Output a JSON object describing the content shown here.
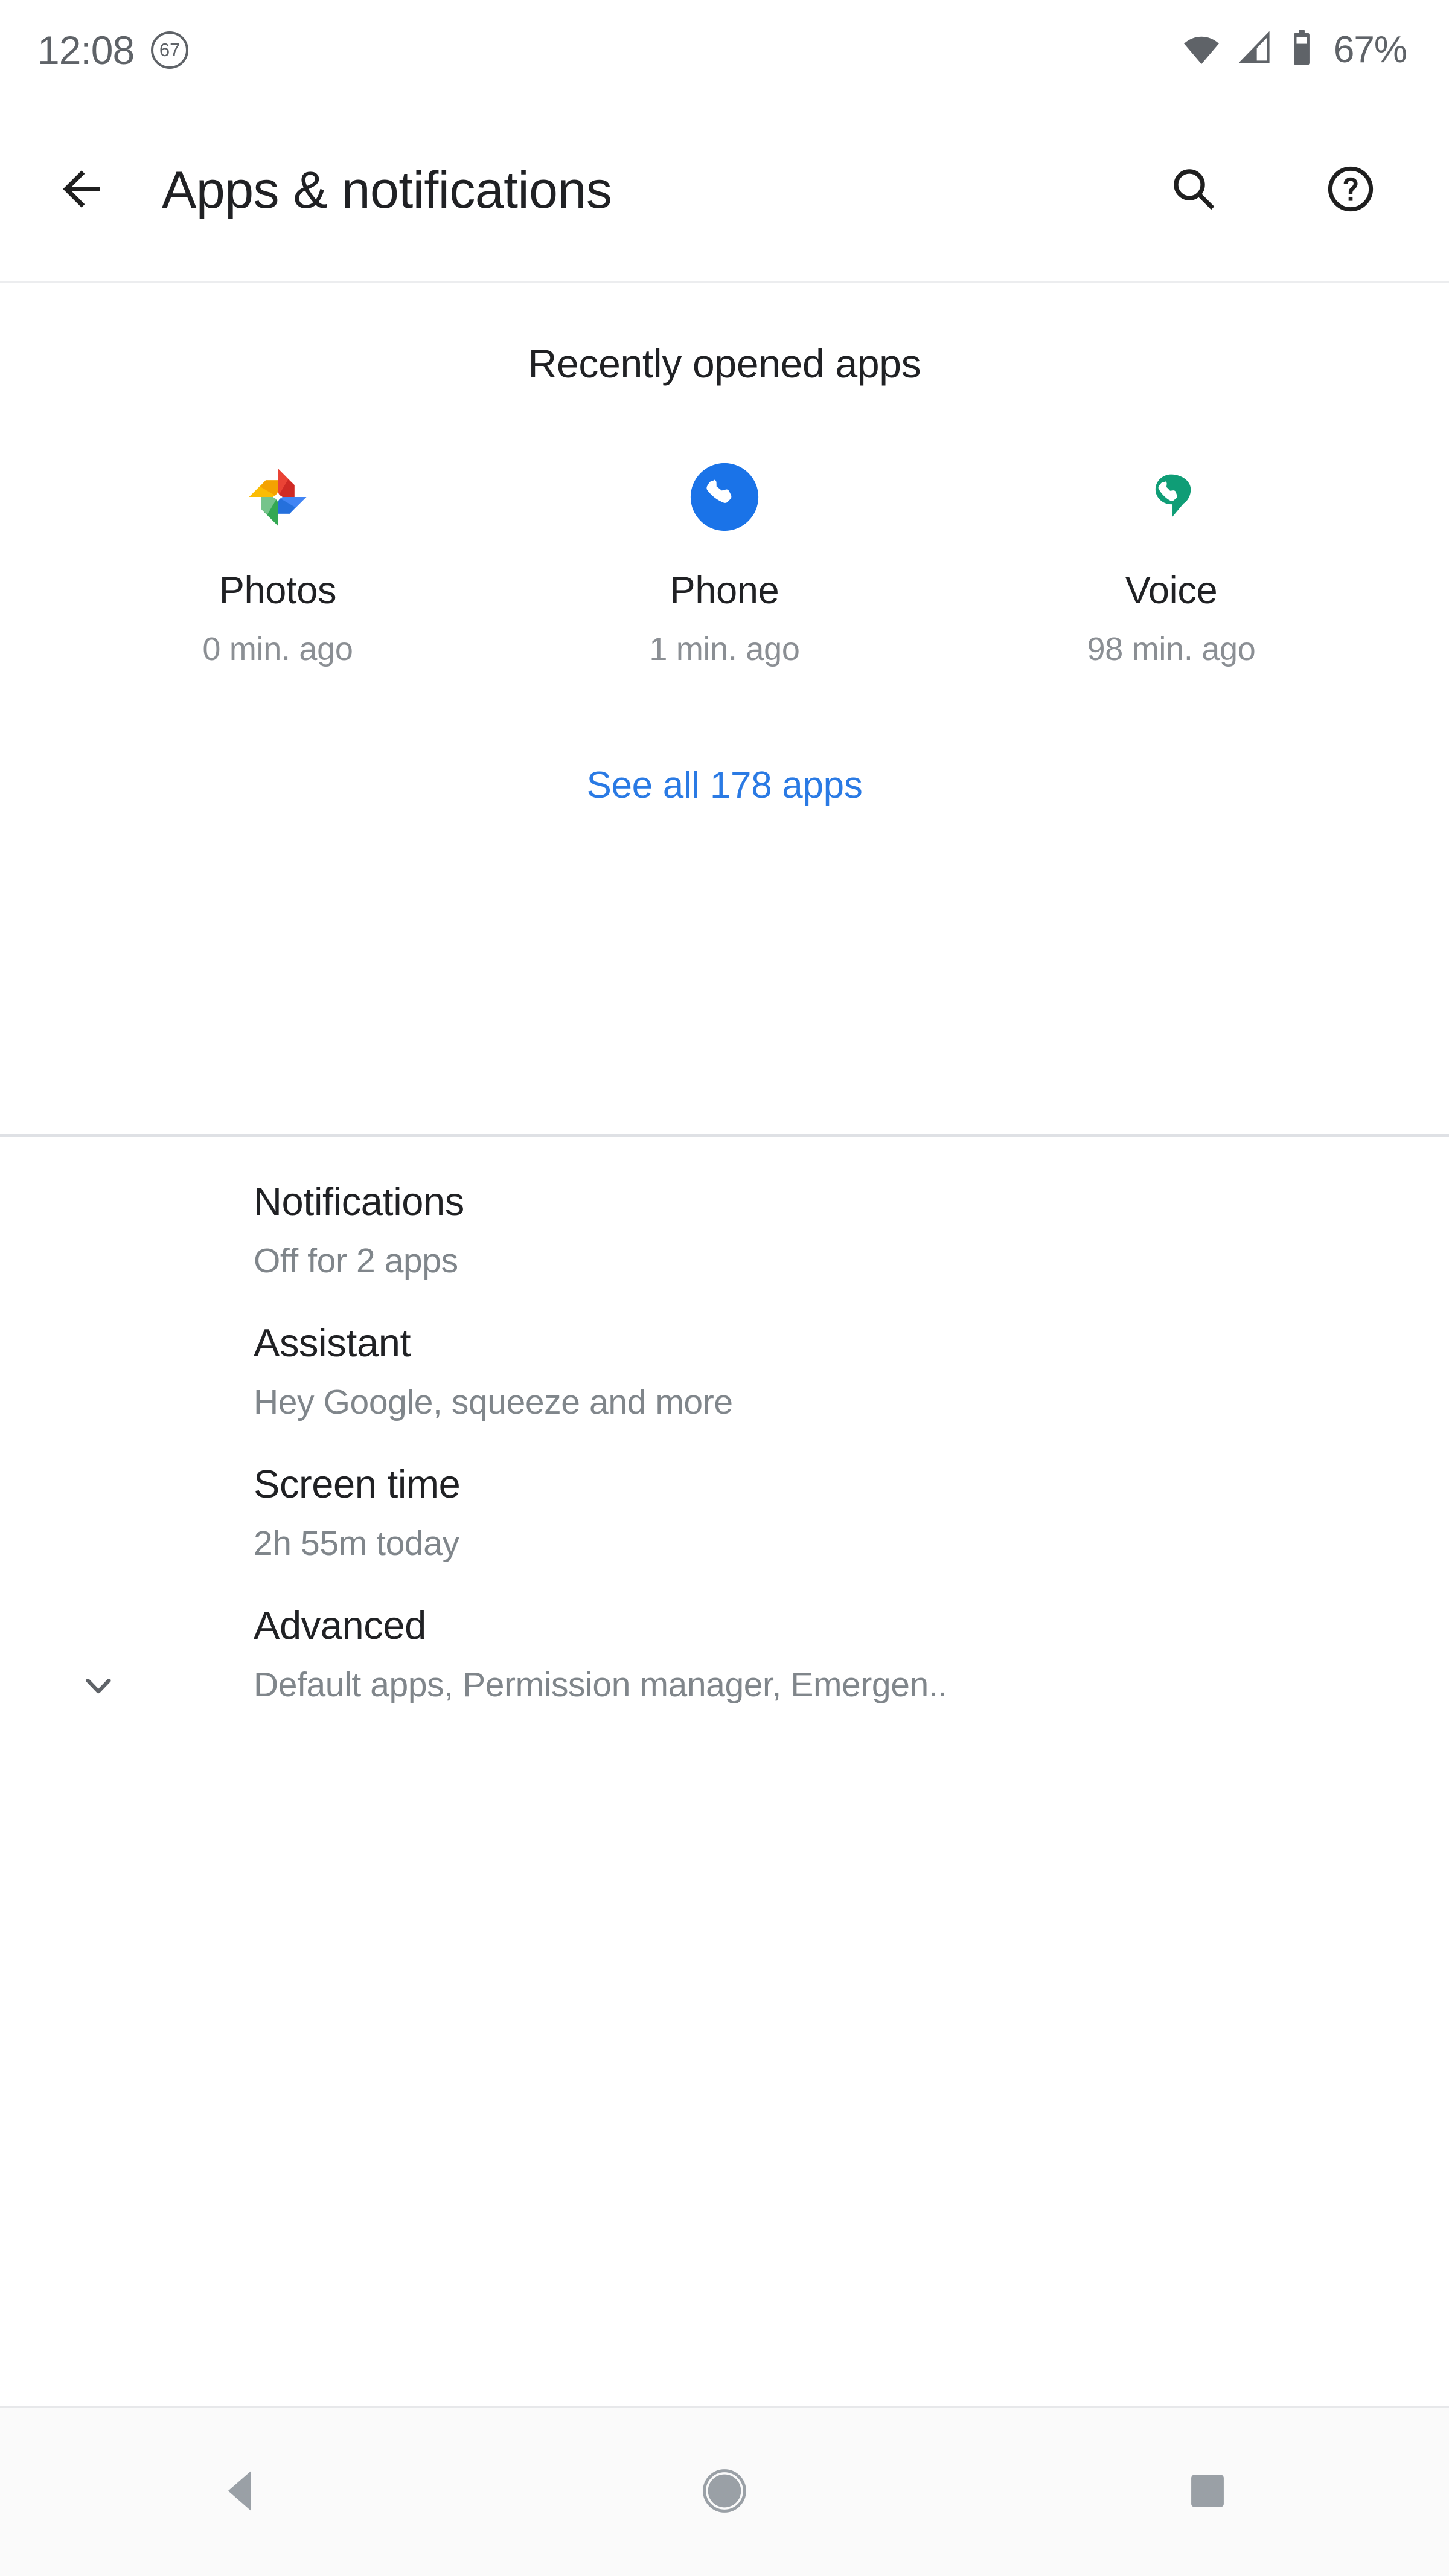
{
  "status_bar": {
    "time": "12:08",
    "notification_badge": "67",
    "wifi_icon": "wifi-icon",
    "signal_icon": "cell-signal-icon",
    "battery_icon": "battery-icon",
    "battery_percent": "67%",
    "icon_color": "#5f6368"
  },
  "app_bar": {
    "back_icon": "arrow-back-icon",
    "title": "Apps & notifications",
    "search_icon": "search-icon",
    "help_icon": "help-circle-icon",
    "title_color": "#202124"
  },
  "recent_apps": {
    "heading": "Recently opened apps",
    "apps": [
      {
        "name": "Photos",
        "time": "0 min. ago",
        "icon": "google-photos-icon"
      },
      {
        "name": "Phone",
        "time": "1 min. ago",
        "icon": "phone-dialer-icon"
      },
      {
        "name": "Voice",
        "time": "98 min. ago",
        "icon": "google-voice-icon"
      }
    ],
    "see_all_label": "See all 178 apps",
    "see_all_color": "#2a7ae4"
  },
  "settings": {
    "items": [
      {
        "title": "Notifications",
        "subtitle": "Off for 2 apps",
        "chevron": false
      },
      {
        "title": "Assistant",
        "subtitle": "Hey Google, squeeze and more",
        "chevron": false
      },
      {
        "title": "Screen time",
        "subtitle": "2h 55m today",
        "chevron": false
      },
      {
        "title": "Advanced",
        "subtitle": "Default apps, Permission manager, Emergen..",
        "chevron": true,
        "chevron_icon": "chevron-down-icon"
      }
    ]
  },
  "nav_bar": {
    "back_icon": "nav-back-triangle-icon",
    "home_icon": "nav-home-circle-icon",
    "recents_icon": "nav-recents-square-icon",
    "icon_color": "#9aa0a6"
  }
}
